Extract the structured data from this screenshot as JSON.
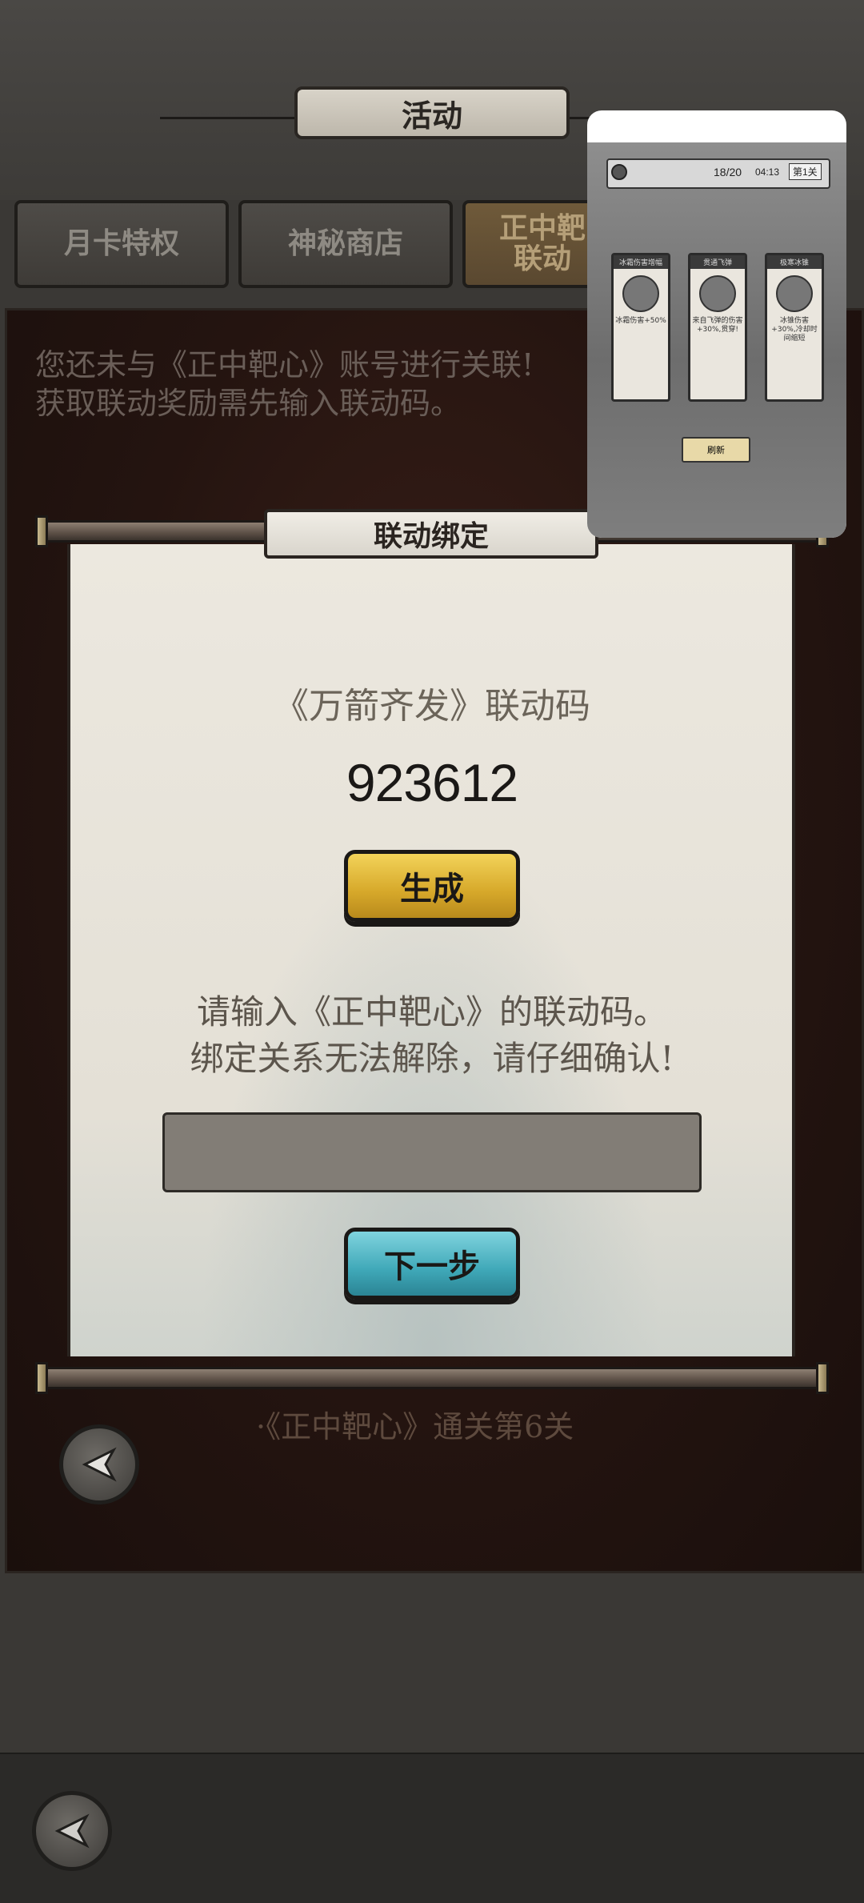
{
  "header": {
    "title": "活动"
  },
  "tabs": [
    {
      "label": "月卡特权"
    },
    {
      "label": "神秘商店"
    },
    {
      "label": "正中靶\n联动"
    }
  ],
  "panel": {
    "notice_line1": "您还未与《正中靶心》账号进行关联!",
    "notice_line2": "获取联动奖励需先输入联动码。",
    "hint": "·《正中靶心》通关第6关"
  },
  "dialog": {
    "title": "联动绑定",
    "code_label": "《万箭齐发》联动码",
    "code_value": "923612",
    "generate_label": "生成",
    "instruction_line1": "请输入《正中靶心》的联动码。",
    "instruction_line2": "绑定关系无法解除，请仔细确认!",
    "input_value": "",
    "next_label": "下一步"
  },
  "preview": {
    "progress": "18/20",
    "timer": "04:13",
    "stage": "第1关",
    "cards": [
      {
        "title": "冰霜伤害增幅",
        "desc": "冰霜伤害+50%"
      },
      {
        "title": "贯通飞弹",
        "desc": "来自飞弹的伤害+30%,贯穿!"
      },
      {
        "title": "极寒冰锥",
        "desc": "冰锥伤害+30%,冷却时间缩短"
      }
    ],
    "refresh_label": "刷新"
  },
  "colors": {
    "generate_button": "#d6a82a",
    "next_button": "#3fa8b8",
    "panel_bg": "#241410",
    "paper": "#ece8df"
  }
}
